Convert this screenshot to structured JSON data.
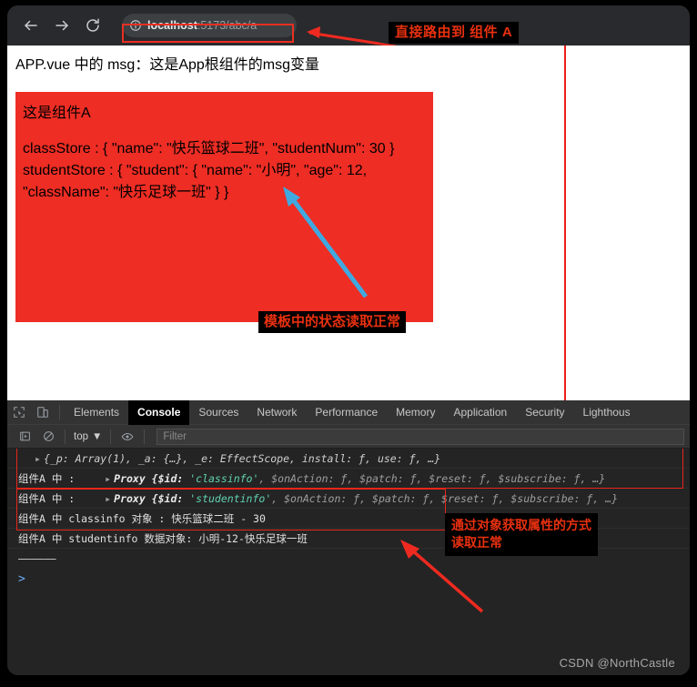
{
  "browser": {
    "nav": {
      "back_icon": "arrow-left-icon",
      "forward_icon": "arrow-right-icon",
      "reload_icon": "reload-icon"
    },
    "omnibox": {
      "info_icon": "info-circle-icon",
      "url_host": "localhost",
      "url_rest": ":5173/abc/a",
      "url_full": "localhost:5173/abc/a"
    }
  },
  "annotations": {
    "top_right": "直接路由到 组件 A",
    "in_page": "模板中的状态读取正常",
    "console": "通过对象获取属性的方式\n读取正常",
    "console_line1": "通过对象获取属性的方式",
    "console_line2": "读取正常"
  },
  "page": {
    "app_msg": "APP.vue 中的 msg：这是App根组件的msg变量",
    "component_title": "这是组件A",
    "class_store_line": "classStore : { \"name\": \"快乐篮球二班\", \"studentNum\": 30 }",
    "student_store_line1": "studentStore : { \"student\": { \"name\": \"小明\", \"age\": 12,",
    "student_store_line2": "\"className\": \"快乐足球一班\" } }"
  },
  "devtools": {
    "icons": {
      "inspect": "inspect-element-icon",
      "device": "device-toolbar-icon",
      "execute": "execute-icon",
      "clear": "clear-console-icon",
      "eye": "eye-icon"
    },
    "tabs": [
      {
        "label": "Elements",
        "active": false
      },
      {
        "label": "Console",
        "active": true
      },
      {
        "label": "Sources",
        "active": false
      },
      {
        "label": "Network",
        "active": false
      },
      {
        "label": "Performance",
        "active": false
      },
      {
        "label": "Memory",
        "active": false
      },
      {
        "label": "Application",
        "active": false
      },
      {
        "label": "Security",
        "active": false
      },
      {
        "label": "Lighthous",
        "active": false
      }
    ],
    "context_selector": "top",
    "context_caret": "▼",
    "filter_placeholder": "Filter",
    "console_rows": {
      "row0_text": "{_p: Array(1), _a: {…}, _e: EffectScope, install: ƒ, use: ƒ, …}",
      "row1_label": "组件A 中 :",
      "row1_proxy_prefix": "Proxy {$id: ",
      "row1_id": "'classinfo'",
      "row1_proxy_suffix": ", $onAction: ƒ, $patch: ƒ, $reset: ƒ, $subscribe: ƒ, …}",
      "row2_label": "组件A 中 :",
      "row2_proxy_prefix": "Proxy {$id: ",
      "row2_id": "'studentinfo'",
      "row2_proxy_suffix": ", $onAction: ƒ, $patch: ƒ, $reset: ƒ, $subscribe: ƒ, …}",
      "row3_text": "组件A 中 classinfo 对象 :    快乐篮球二班 - 30",
      "row4_text": "组件A 中 studentinfo 数据对象:    小明-12-快乐足球一班",
      "row5_text": "——————",
      "prompt": ">"
    }
  },
  "watermark": "CSDN @NorthCastle",
  "colors": {
    "accent_red": "#ee2d24",
    "annotation_text": "#e8300f",
    "highlight_border": "#e8251c",
    "blue_arrow": "#3fa9e0",
    "devtools_bg": "#242424",
    "toolbar_bg": "#292a2d"
  }
}
